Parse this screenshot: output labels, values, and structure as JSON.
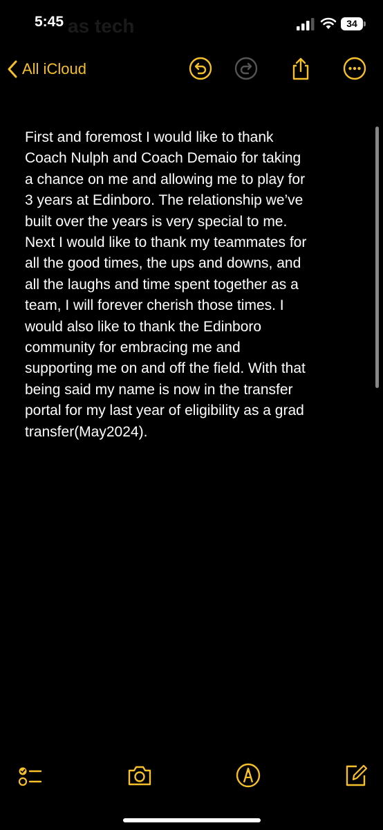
{
  "status_bar": {
    "time": "5:45",
    "ghost_title": "as tech",
    "battery_level": "34",
    "signal_icon": "cellular-signal-icon",
    "wifi_icon": "wifi-icon"
  },
  "nav": {
    "back_label": "All iCloud",
    "accent_color": "#f5c02a",
    "icons": [
      "chevron-left-icon",
      "undo-icon",
      "redo-icon",
      "share-icon",
      "more-icon"
    ]
  },
  "note": {
    "lines": "First and foremost I would like to thank\nCoach Nulph and Coach Demaio for taking\na chance on me and allowing me to play for\n3 years at Edinboro. The relationship we’ve\nbuilt over the years is very special to me.\nNext I would like to thank my teammates for\nall the good times, the ups and downs, and\nall the laughs and time spent together as a\nteam, I will forever cherish those times. I\nwould also like to thank the Edinboro\ncommunity for embracing me and\nsupporting me on and off the field. With that\nbeing said my name is now in the transfer\nportal for my last year of eligibility as a grad\ntransfer(May2024)."
  },
  "toolbar": {
    "icons": [
      "checklist-icon",
      "camera-icon",
      "markup-pen-icon",
      "compose-icon"
    ]
  }
}
